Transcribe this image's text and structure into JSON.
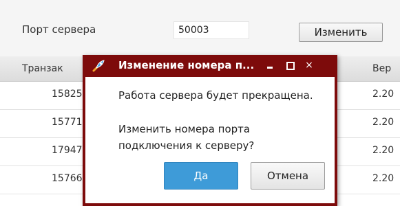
{
  "server": {
    "port_label": "Порт сервера",
    "port_value": "50003",
    "change_button_label": "Изменить"
  },
  "table": {
    "headers": [
      "Транзак",
      "Вер"
    ],
    "rows": [
      [
        "15825",
        "2.20"
      ],
      [
        "15771",
        "2.20"
      ],
      [
        "17947",
        "2.20"
      ],
      [
        "15766",
        "2.20"
      ]
    ]
  },
  "dialog": {
    "title": "Изменение номера п...",
    "icon": "rocket-icon",
    "message_line1": "Работа сервера будет прекращена.",
    "message_line2": "Изменить номера порта подключения к серверу?",
    "yes_label": "Да",
    "cancel_label": "Отмена",
    "window_controls": {
      "minimize": "minimize-icon",
      "maximize": "maximize-icon",
      "close": "×"
    }
  },
  "colors": {
    "dialog_frame": "#7d0b0b",
    "primary_button": "#3e9bd8",
    "background": "#f5f5f5"
  }
}
